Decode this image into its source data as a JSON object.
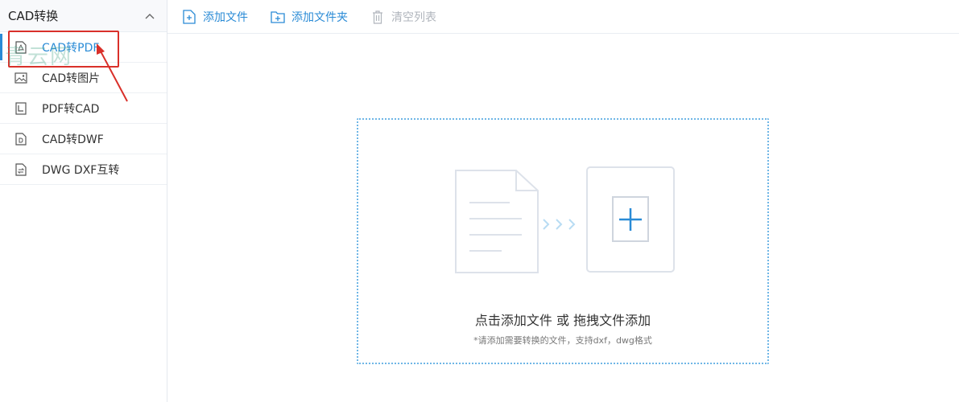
{
  "sidebar": {
    "header": "CAD转换",
    "items": [
      {
        "label": "CAD转PDF",
        "icon": "pdf-file-icon"
      },
      {
        "label": "CAD转图片",
        "icon": "image-icon"
      },
      {
        "label": "PDF转CAD",
        "icon": "cad-file-icon"
      },
      {
        "label": "CAD转DWF",
        "icon": "dwf-file-icon"
      },
      {
        "label": "DWG DXF互转",
        "icon": "swap-file-icon"
      }
    ]
  },
  "toolbar": {
    "add_file": "添加文件",
    "add_folder": "添加文件夹",
    "clear_list": "清空列表"
  },
  "dropzone": {
    "main_text": "点击添加文件 或 拖拽文件添加",
    "sub_text": "*请添加需要转换的文件，支持dxf，dwg格式"
  },
  "watermark": "青云网",
  "colors": {
    "accent": "#2a8bd6",
    "annotation": "#d9302a",
    "disabled": "#b0b5bc"
  }
}
